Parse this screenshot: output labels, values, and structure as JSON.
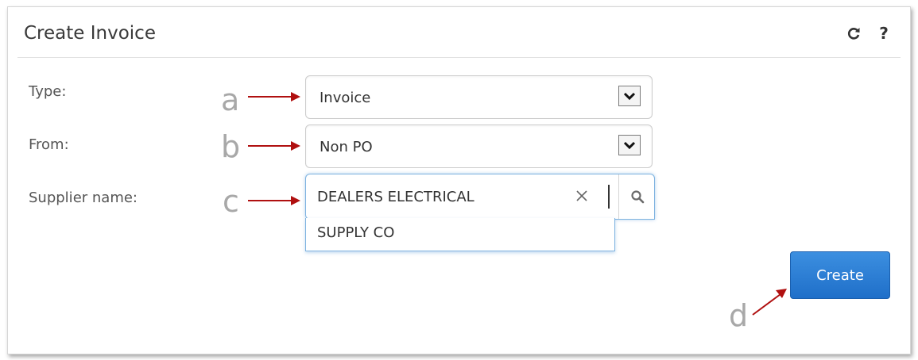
{
  "header": {
    "title": "Create Invoice",
    "refresh_icon": "refresh-icon",
    "help_label": "?"
  },
  "form": {
    "type": {
      "label": "Type:",
      "value": "Invoice"
    },
    "from": {
      "label": "From:",
      "value": "Non PO"
    },
    "supplier": {
      "label": "Supplier name:",
      "value_line1": "DEALERS ELECTRICAL",
      "value_line2": "SUPPLY CO"
    },
    "create_label": "Create"
  },
  "annotations": {
    "a": "a",
    "b": "b",
    "c": "c",
    "d": "d"
  },
  "colors": {
    "accent": "#2a7fd4",
    "arrow": "#b01010",
    "annotation_text": "#a8a8a8"
  }
}
